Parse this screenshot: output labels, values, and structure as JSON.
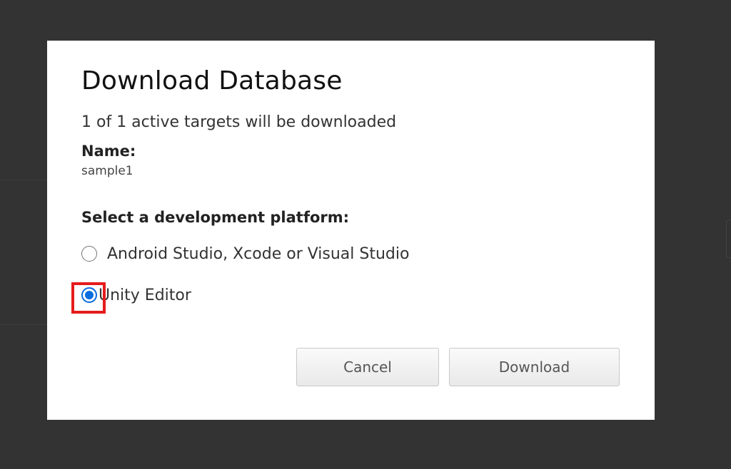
{
  "dialog": {
    "title": "Download Database",
    "summary": "1 of 1 active targets will be downloaded",
    "name_label": "Name:",
    "name_value": "sample1",
    "platform_label": "Select a development platform:",
    "options": [
      {
        "label": "Android Studio, Xcode or Visual Studio",
        "selected": false
      },
      {
        "label": "Unity Editor",
        "selected": true
      }
    ],
    "buttons": {
      "cancel": "Cancel",
      "download": "Download"
    }
  },
  "colors": {
    "backdrop": "#333333",
    "radio_accent": "#0a6cde",
    "highlight": "#e51c1c"
  }
}
